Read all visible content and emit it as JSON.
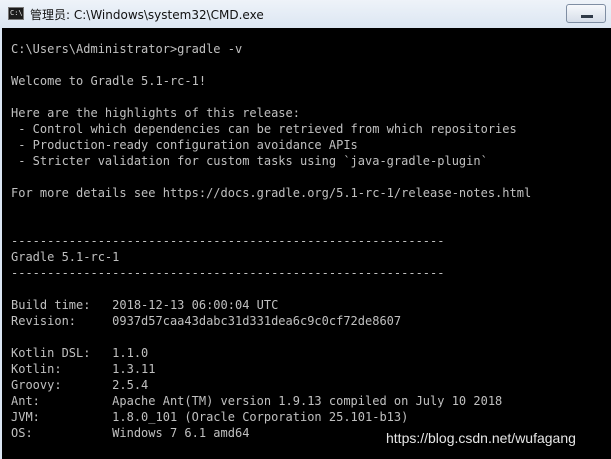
{
  "window": {
    "title": "管理员: C:\\Windows\\system32\\CMD.exe",
    "icon": "cmd-icon",
    "icon_label": "C:\\."
  },
  "console": {
    "prompt": "C:\\Users\\Administrator>gradle -v",
    "welcome": "Welcome to Gradle 5.1-rc-1!",
    "highlights_title": "Here are the highlights of this release:",
    "highlights": [
      " - Control which dependencies can be retrieved from which repositories",
      " - Production-ready configuration avoidance APIs",
      " - Stricter validation for custom tasks using `java-gradle-plugin`"
    ],
    "more_details": "For more details see https://docs.gradle.org/5.1-rc-1/release-notes.html",
    "separator": "------------------------------------------------------------",
    "version_header": "Gradle 5.1-rc-1",
    "info_1": [
      "Build time:   2018-12-13 06:00:04 UTC",
      "Revision:     0937d57caa43dabc31d331dea6c9c0cf72de8607"
    ],
    "info_2": [
      "Kotlin DSL:   1.1.0",
      "Kotlin:       1.3.11",
      "Groovy:       2.5.4",
      "Ant:          Apache Ant(TM) version 1.9.13 compiled on July 10 2018",
      "JVM:          1.8.0_101 (Oracle Corporation 25.101-b13)",
      "OS:           Windows 7 6.1 amd64"
    ]
  },
  "watermark": "https://blog.csdn.net/wufagang"
}
